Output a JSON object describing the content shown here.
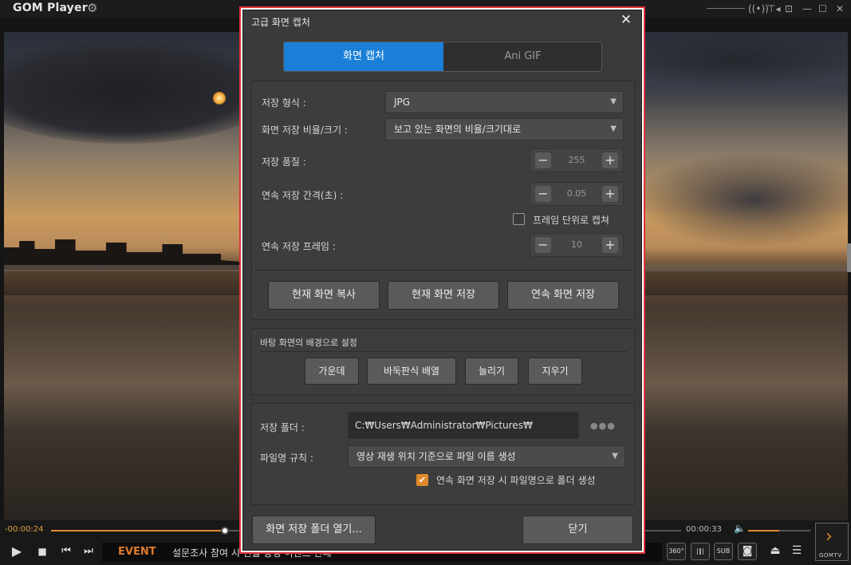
{
  "app": {
    "logo": "GOM Player",
    "top_controls": {
      "pin": "⊤◂",
      "surround": "((•))",
      "theme": "⊡",
      "minimize": "—",
      "maximize": "☐",
      "close": "✕"
    }
  },
  "dialog": {
    "title": "고급 화면 캡처",
    "close_glyph": "✕",
    "tabs": {
      "capture": "화면 캡처",
      "gif": "Ani GIF"
    },
    "format": {
      "label": "저장 형식 :",
      "value": "JPG"
    },
    "ratio": {
      "label": "화면 저장 비율/크기 :",
      "value": "보고 있는 화면의 비율/크기대로"
    },
    "quality": {
      "label": "저장 품질 :",
      "value": "255"
    },
    "interval": {
      "label": "연속 저장 간격(초) :",
      "value": "0.05"
    },
    "frame_unit": {
      "label": "프레임 단위로 캡쳐",
      "checked": false
    },
    "frames": {
      "label": "연속 저장 프레임 :",
      "value": "10"
    },
    "stepper": {
      "minus": "−",
      "plus": "+"
    },
    "actions": {
      "copy": "현재 화면 복사",
      "save": "현재 화면 저장",
      "burst": "연속 화면 저장"
    },
    "wallpaper": {
      "title": "바탕 화면의 배경으로 설정",
      "center": "가운데",
      "tile": "바둑판식 배열",
      "stretch": "늘리기",
      "clear": "지우기"
    },
    "folder": {
      "label": "저장 폴더 :",
      "path": "C:₩Users₩Administrator₩Pictures₩",
      "browse": "●●●"
    },
    "naming": {
      "label": "파일명 규칙 :",
      "value": "영상 재생 위치 기준으로 파일 이름 생성"
    },
    "subfolder": {
      "label": "연속 화면 저장 시 파일명으로 폴더 생성",
      "checked": true
    },
    "open_folder": "화면 저장 폴더 열기...",
    "close": "닫기",
    "arrow": "▼",
    "check_mark": "✔"
  },
  "player": {
    "time_elapsed": "-00:00:24",
    "time_remaining": "00:00:33",
    "seek_progress": 0.28,
    "volume_level": 0.5,
    "event_label": "EVENT",
    "event_text": "설문조사 참여 시 선물 증정 이벤트 안내",
    "buttons": {
      "play": "▶",
      "stop": "■",
      "prev": "⏮",
      "next": "⏭",
      "vol": "🔈"
    },
    "right_buttons": {
      "r360": "360°",
      "eq": "|‖|",
      "sub": "SUB",
      "cam": "◙",
      "eject": "⏏",
      "menu": "☰"
    },
    "gomtv": {
      "arrow": "›",
      "label": "GOMTV"
    }
  },
  "colors": {
    "accent": "#1a7fd6",
    "orange": "#e08a2a",
    "highlight_border": "#e0303a"
  }
}
